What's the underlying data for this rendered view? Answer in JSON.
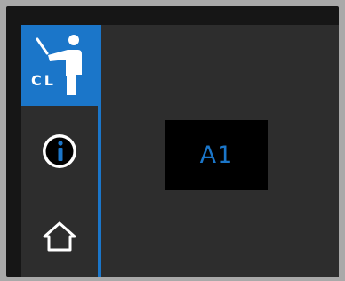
{
  "sidebar": {
    "items": [
      {
        "icon": "teacher-pointer-icon",
        "label": "CL",
        "active": true
      },
      {
        "icon": "info-icon",
        "active": false
      },
      {
        "icon": "home-icon",
        "active": false
      }
    ]
  },
  "main": {
    "value": "A1"
  },
  "colors": {
    "accent": "#1b76c9",
    "screen_background": "#2d2d2d",
    "value_box_background": "#000000",
    "icon_white": "#ffffff",
    "bezel": "#161616"
  }
}
